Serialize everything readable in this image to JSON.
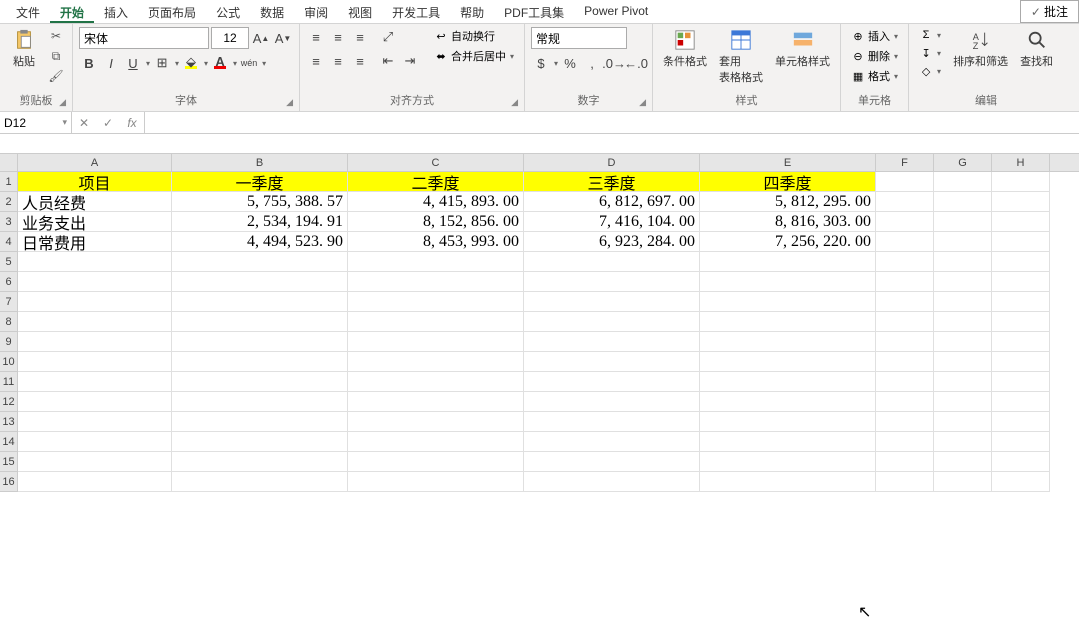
{
  "tabs": {
    "items": [
      "文件",
      "开始",
      "插入",
      "页面布局",
      "公式",
      "数据",
      "审阅",
      "视图",
      "开发工具",
      "帮助",
      "PDF工具集",
      "Power Pivot"
    ],
    "active": 1,
    "comment": "批注"
  },
  "ribbon": {
    "clipboard": {
      "paste": "粘贴",
      "label": "剪贴板"
    },
    "font": {
      "name": "宋体",
      "size": "12",
      "bold": "B",
      "italic": "I",
      "underline": "U",
      "label": "字体",
      "pinyin": "wén"
    },
    "align": {
      "wrap": "自动换行",
      "merge": "合并后居中",
      "label": "对齐方式"
    },
    "number": {
      "format": "常规",
      "label": "数字"
    },
    "styles": {
      "cond": "条件格式",
      "table": "套用\n表格格式",
      "cell": "单元格样式",
      "label": "样式"
    },
    "cells": {
      "insert": "插入",
      "delete": "删除",
      "format": "格式",
      "label": "单元格"
    },
    "editing": {
      "sort": "排序和筛选",
      "find": "查找和",
      "label": "编辑"
    }
  },
  "formula_bar": {
    "name_box": "D12",
    "fx": "fx"
  },
  "grid": {
    "cols": [
      "A",
      "B",
      "C",
      "D",
      "E",
      "F",
      "G",
      "H"
    ],
    "header_row": [
      "项目",
      "一季度",
      "二季度",
      "三季度",
      "四季度"
    ],
    "rows": [
      {
        "cat": "人员经费",
        "vals": [
          "5, 755, 388. 57",
          "4, 415, 893. 00",
          "6, 812, 697. 00",
          "5, 812, 295. 00"
        ]
      },
      {
        "cat": "业务支出",
        "vals": [
          "2, 534, 194. 91",
          "8, 152, 856. 00",
          "7, 416, 104. 00",
          "8, 816, 303. 00"
        ]
      },
      {
        "cat": "日常费用",
        "vals": [
          "4, 494, 523. 90",
          "8, 453, 993. 00",
          "6, 923, 284. 00",
          "7, 256, 220. 00"
        ]
      }
    ]
  },
  "chart_data": {
    "type": "table",
    "title": "",
    "columns": [
      "项目",
      "一季度",
      "二季度",
      "三季度",
      "四季度"
    ],
    "rows": [
      [
        "人员经费",
        5755388.57,
        4415893.0,
        6812697.0,
        5812295.0
      ],
      [
        "业务支出",
        2534194.91,
        8152856.0,
        7416104.0,
        8816303.0
      ],
      [
        "日常费用",
        4494523.9,
        8453993.0,
        6923284.0,
        7256220.0
      ]
    ]
  }
}
